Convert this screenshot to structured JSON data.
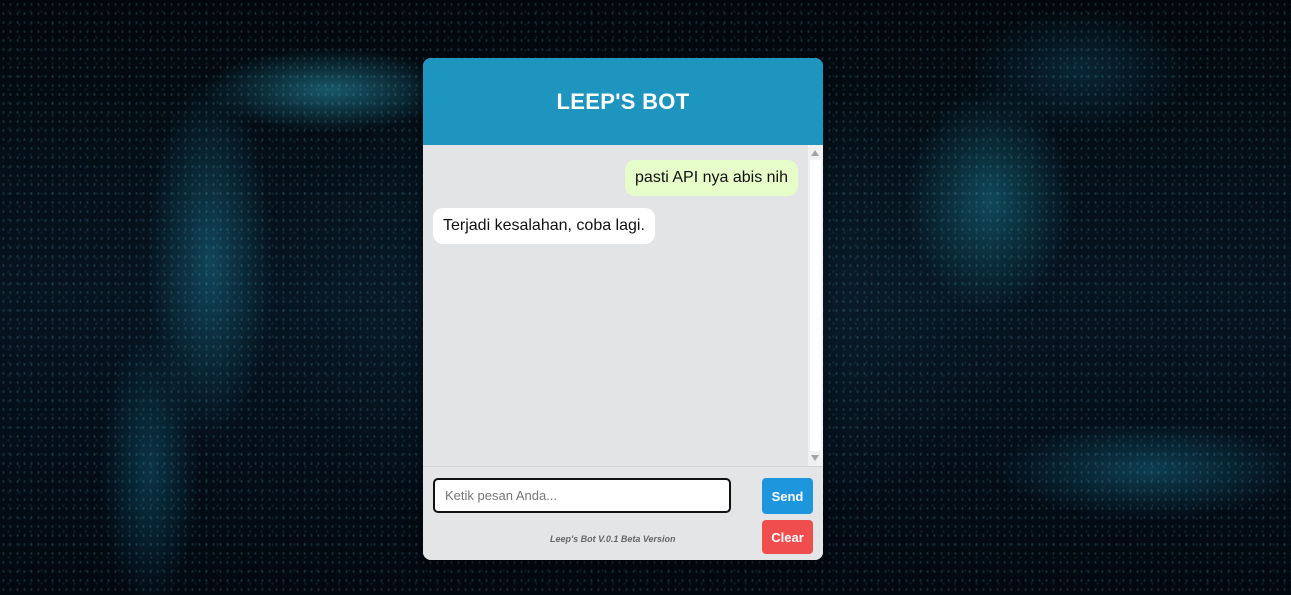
{
  "header": {
    "title": "LEEP'S BOT"
  },
  "messages": [
    {
      "sender": "user",
      "text": "pasti API nya abis nih"
    },
    {
      "sender": "bot",
      "text": "Terjadi kesalahan, coba lagi."
    }
  ],
  "input": {
    "value": "",
    "placeholder": "Ketik pesan Anda..."
  },
  "buttons": {
    "send_label": "Send",
    "clear_label": "Clear"
  },
  "footer": {
    "version_text": "Leep's Bot V.0.1 Beta Version"
  },
  "colors": {
    "header": "#1e95be",
    "send": "#1e96de",
    "clear": "#f04e4e",
    "user_bubble": "#e6fcc9",
    "bot_bubble": "#ffffff"
  }
}
